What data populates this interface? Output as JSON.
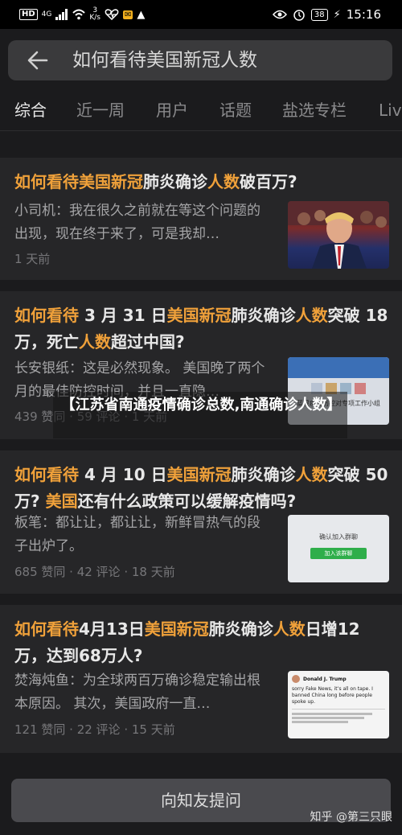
{
  "status_bar": {
    "network_type": "HD",
    "signal": "4G",
    "data_rate_value": "3",
    "data_rate_unit": "K/s",
    "battery": "38",
    "time": "15:16"
  },
  "search": {
    "query": "如何看待美国新冠人数"
  },
  "tabs": [
    "综合",
    "近一周",
    "用户",
    "话题",
    "盐选专栏",
    "Liv"
  ],
  "cards": [
    {
      "title_segments": [
        {
          "text": "如何看待美国新冠",
          "highlight": true
        },
        {
          "text": "肺炎确诊",
          "highlight": false
        },
        {
          "text": "人数",
          "highlight": true
        },
        {
          "text": "破百万?",
          "highlight": false
        }
      ],
      "excerpt": "小司机：我在很久之前就在等这个问题的出现，现在终于来了，可是我却…",
      "meta": "1 天前"
    },
    {
      "title_segments": [
        {
          "text": "如何看待",
          "highlight": true
        },
        {
          "text": " 3 月 31 日",
          "highlight": false
        },
        {
          "text": "美国新冠",
          "highlight": true
        },
        {
          "text": "肺炎确诊",
          "highlight": false
        },
        {
          "text": "人数",
          "highlight": true
        },
        {
          "text": "突破 18 万，死亡",
          "highlight": false
        },
        {
          "text": "人数",
          "highlight": true
        },
        {
          "text": "超过中国?",
          "highlight": false
        }
      ],
      "excerpt": "长安银纸：这是必然现象。 美国晚了两个月的最佳防控时间，并且一直隐…",
      "meta": "439 赞同 · 59 评论 · 1 天前"
    },
    {
      "title_segments": [
        {
          "text": "如何看待",
          "highlight": true
        },
        {
          "text": " 4 月 10 日",
          "highlight": false
        },
        {
          "text": "美国新冠",
          "highlight": true
        },
        {
          "text": "肺炎确诊",
          "highlight": false
        },
        {
          "text": "人数",
          "highlight": true
        },
        {
          "text": "突破 50万? ",
          "highlight": false
        },
        {
          "text": "美国",
          "highlight": true
        },
        {
          "text": "还有什么政策可以缓解疫情吗?",
          "highlight": false
        }
      ],
      "excerpt": "板笔：都让让，都让让，新鲜冒热气的段子出炉了。",
      "meta": "685 赞同 · 42 评论 · 18 天前"
    },
    {
      "title_segments": [
        {
          "text": "如何看待",
          "highlight": true
        },
        {
          "text": "4月13日",
          "highlight": false
        },
        {
          "text": "美国新冠",
          "highlight": true
        },
        {
          "text": "肺炎确诊",
          "highlight": false
        },
        {
          "text": "人数",
          "highlight": true
        },
        {
          "text": "日增12万，达到68万人?",
          "highlight": false
        }
      ],
      "excerpt": "焚海炖鱼：为全球两百万确诊稳定输出根本原因。 其次，美国政府一直…",
      "meta": "121 赞同 · 22 评论 · 15 天前"
    }
  ],
  "overlay_caption": "【江苏省南通疫情确诊总数,南通确诊人数】",
  "thumb_texts": {
    "thumb2_caption": "蓝星疫情防控对专项工作小组",
    "thumb3_title": "确认加入群聊",
    "thumb3_button": "加入该群聊",
    "thumb4_name": "Donald J. Trump",
    "thumb4_body": "sorry Fake News, it’s all on tape. I banned China long before people spoke up."
  },
  "bottom": {
    "ask_button": "向知友提问",
    "watermark": "知乎 @第三只眼"
  },
  "colors": {
    "highlight": "#f0a13a",
    "background": "#1b1b1d",
    "card": "#262628"
  }
}
